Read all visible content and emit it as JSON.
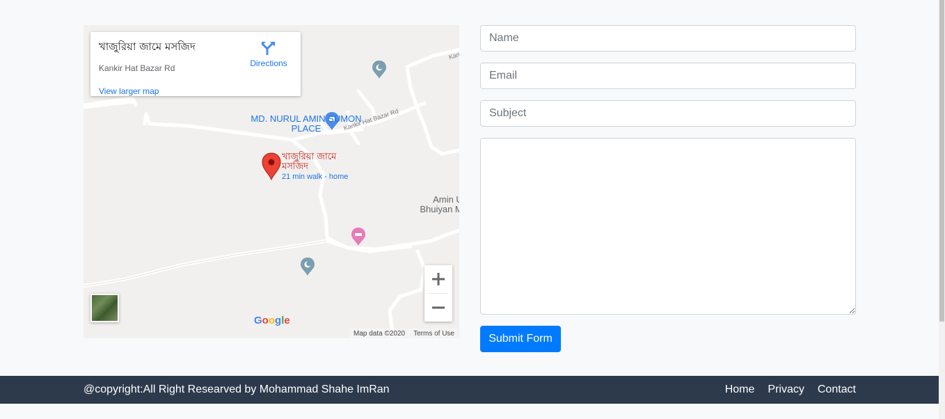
{
  "map": {
    "info_card": {
      "title": "খাজুরিয়া জামে মসজিদ",
      "address": "Kankir Hat Bazar Rd",
      "larger_map_link": "View larger map",
      "directions_label": "Directions"
    },
    "places": {
      "nurul_amin": "MD. NURUL AMIN SUMON PLACE",
      "amin_ud": "Amin Ud Bhuiyan Ma",
      "marker_name": "খাজুরিয়া জামে মসজিদ",
      "marker_sub": "21 min walk - home"
    },
    "roads": {
      "road_main": "Kankir Hat Bazar Rd",
      "road_edge": "Kan"
    },
    "attribution": {
      "logo": "Google",
      "map_data": "Map data ©2020",
      "terms": "Terms of Use"
    },
    "controls": {
      "zoom_in": "+",
      "zoom_out": "−"
    }
  },
  "form": {
    "name_placeholder": "Name",
    "email_placeholder": "Email",
    "subject_placeholder": "Subject",
    "message_value": "",
    "submit_label": "Submit Form"
  },
  "footer": {
    "copyright": "@copyright:All Right Researved by Mohammad Shahe ImRan",
    "links": [
      "Home",
      "Privacy",
      "Contact"
    ]
  },
  "colors": {
    "primary_button": "#007bff",
    "footer_bg": "#2c3a4c",
    "page_bg": "#f8f9fa",
    "map_link": "#1a73e8",
    "marker_red": "#ea4335"
  }
}
